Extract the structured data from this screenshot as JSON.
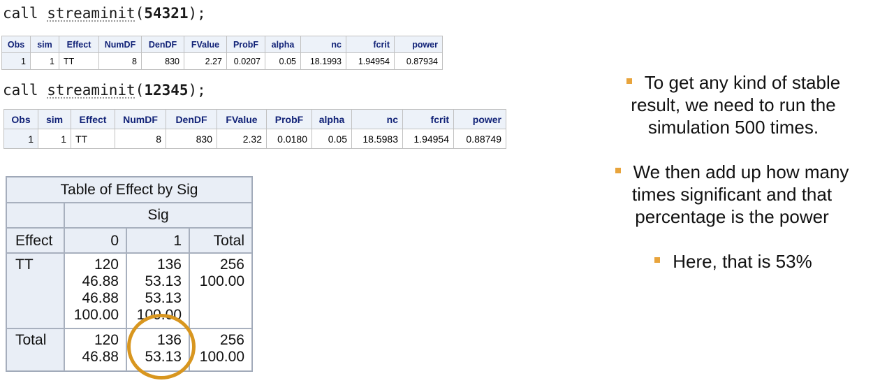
{
  "code1": {
    "prefix": "call ",
    "fn": "streaminit",
    "open": "(",
    "seed": "54321",
    "close": ");"
  },
  "code2": {
    "prefix": "call ",
    "fn": "streaminit",
    "open": "(",
    "seed": "12345",
    "close": ");"
  },
  "table_headers": [
    "Obs",
    "sim",
    "Effect",
    "NumDF",
    "DenDF",
    "FValue",
    "ProbF",
    "alpha",
    "nc",
    "fcrit",
    "power"
  ],
  "table1_row": [
    "1",
    "1",
    "TT",
    "8",
    "830",
    "2.27",
    "0.0207",
    "0.05",
    "18.1993",
    "1.94954",
    "0.87934"
  ],
  "table2_row": [
    "1",
    "1",
    "TT",
    "8",
    "830",
    "2.32",
    "0.0180",
    "0.05",
    "18.5983",
    "1.94954",
    "0.88749"
  ],
  "freq": {
    "title": "Table of Effect by Sig",
    "sig_label": "Sig",
    "effect_label": "Effect",
    "col0": "0",
    "col1": "1",
    "col_total": "Total",
    "row1_label": "TT",
    "row1_c0": [
      "120",
      "46.88",
      "46.88",
      "100.00"
    ],
    "row1_c1": [
      "136",
      "53.13",
      "53.13",
      "100.00"
    ],
    "row1_tot": [
      "256",
      "100.00"
    ],
    "row2_label": "Total",
    "row2_c0": [
      "120",
      "46.88"
    ],
    "row2_c1": [
      "136",
      "53.13"
    ],
    "row2_tot": [
      "256",
      "100.00"
    ]
  },
  "bullets": {
    "b1": [
      "To get any kind of stable",
      "result, we need to run the",
      "simulation 500 times."
    ],
    "b2": [
      "We then add up how many",
      "times significant and that",
      "percentage is the power"
    ],
    "b3": "Here, that is 53%"
  },
  "colors": {
    "accent": "#d8961f",
    "bullet": "#e8a43c",
    "header_bg": "#edf2f9",
    "header_text": "#112277"
  }
}
